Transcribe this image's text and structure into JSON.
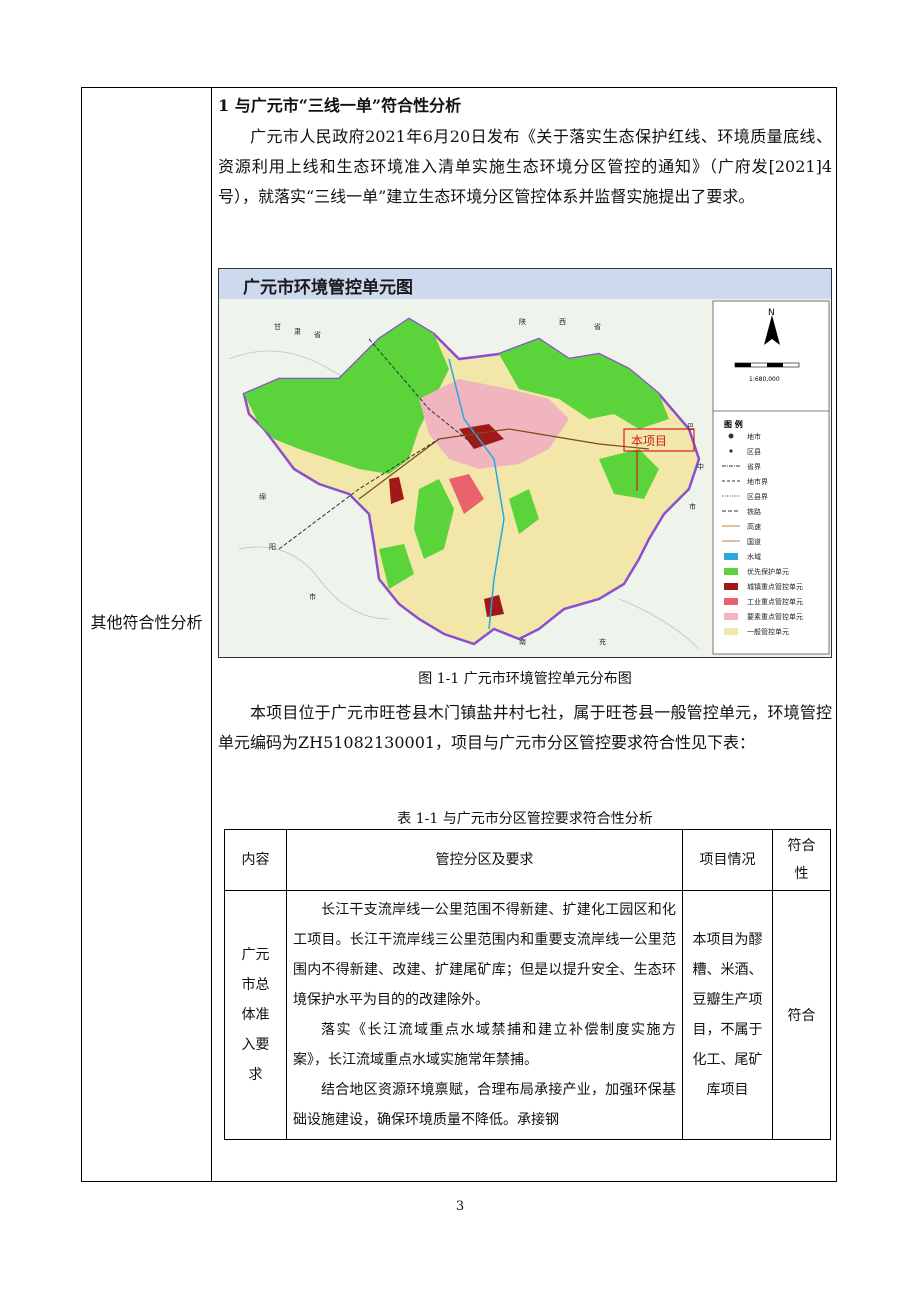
{
  "left_label": "其他符合性分析",
  "section": {
    "heading": "1 与广元市“三线一单”符合性分析",
    "intro": "广元市人民政府2021年6月20日发布《关于落实生态保护红线、环境质量底线、资源利用上线和生态环境准入清单实施生态环境分区管控的通知》（广府发[2021]4号），就落实“三线一单”建立生态环境分区管控体系并监督实施提出了要求。"
  },
  "map": {
    "title": "广元市环境管控单元图",
    "project_label": "本项目",
    "province_labels": [
      "甘",
      "肃",
      "省",
      "陕",
      "西",
      "省",
      "巴",
      "中",
      "市",
      "绵",
      "阳",
      "市",
      "南",
      "充"
    ],
    "scale_label": "1:680,000",
    "north_label": "N",
    "legend_title": "图  例",
    "legend": [
      {
        "label": "地市",
        "type": "point"
      },
      {
        "label": "区县",
        "type": "point-small"
      },
      {
        "label": "省界",
        "type": "line-dashdot"
      },
      {
        "label": "地市界",
        "type": "line-dash"
      },
      {
        "label": "区县界",
        "type": "line-dot"
      },
      {
        "label": "铁路",
        "type": "line-rail"
      },
      {
        "label": "高速",
        "type": "line-highway"
      },
      {
        "label": "国道",
        "type": "line-road"
      },
      {
        "label": "水域",
        "type": "fill",
        "color": "#29a8e0"
      },
      {
        "label": "优先保护单元",
        "type": "fill",
        "color": "#5ad43a"
      },
      {
        "label": "城镇重点管控单元",
        "type": "fill",
        "color": "#a01818"
      },
      {
        "label": "工业重点管控单元",
        "type": "fill",
        "color": "#e8636b"
      },
      {
        "label": "要素重点管控单元",
        "type": "fill",
        "color": "#f1b5c0"
      },
      {
        "label": "一般管控单元",
        "type": "fill",
        "color": "#f2e6a8"
      }
    ]
  },
  "figure_caption": "图 1-1    广元市环境管控单元分布图",
  "project_para": "本项目位于广元市旺苍县木门镇盐井村七社，属于旺苍县一般管控单元，环境管控单元编码为ZH51082130001，项目与广元市分区管控要求符合性见下表：",
  "table_caption": "表 1-1 与广元市分区管控要求符合性分析",
  "table": {
    "headers": [
      "内容",
      "管控分区及要求",
      "项目情况",
      "符合性"
    ],
    "row": {
      "content": "广元市总体准入要求",
      "requirements": [
        "长江干支流岸线一公里范围不得新建、扩建化工园区和化工项目。长江干流岸线三公里范围内和重要支流岸线一公里范围内不得新建、改建、扩建尾矿库；但是以提升安全、生态环境保护水平为目的的改建除外。",
        "落实《长江流域重点水域禁捕和建立补偿制度实施方案》，长江流域重点水域实施常年禁捕。",
        "结合地区资源环境禀赋，合理布局承接产业，加强环保基础设施建设，确保环境质量不降低。承接钢"
      ],
      "project": "本项目为醪糟、米酒、豆瓣生产项目，不属于化工、尾矿库项目",
      "result": "符合"
    }
  },
  "page_number": "3"
}
